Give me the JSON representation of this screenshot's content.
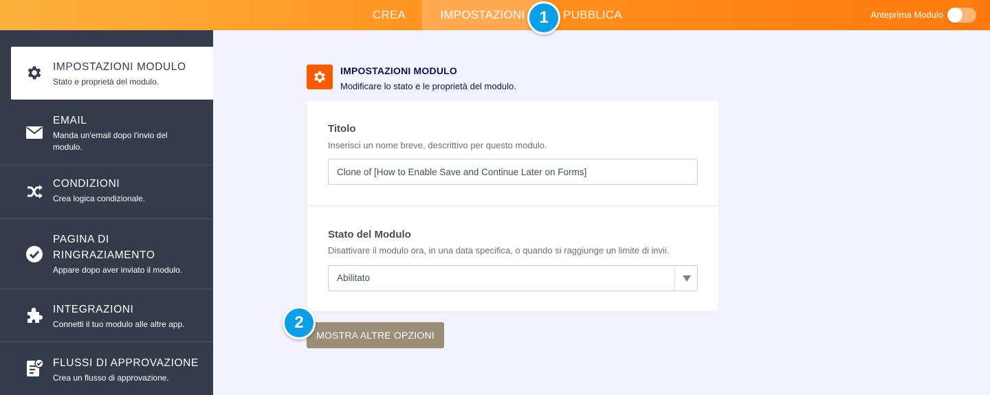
{
  "topbar": {
    "tabs": [
      {
        "label": "CREA"
      },
      {
        "label": "IMPOSTAZIONI"
      },
      {
        "label": "PUBBLICA"
      }
    ],
    "preview_label": "Anteprima Modulo",
    "preview_enabled": false
  },
  "badges": {
    "one": "1",
    "two": "2"
  },
  "sidebar": {
    "items": [
      {
        "title": "IMPOSTAZIONI MODULO",
        "desc": "Stato e proprietà del modulo.",
        "icon": "gear-icon"
      },
      {
        "title": "EMAIL",
        "desc": "Manda un'email dopo l'invio del modulo.",
        "icon": "envelope-icon"
      },
      {
        "title": "CONDIZIONI",
        "desc": "Crea logica condizionale.",
        "icon": "shuffle-icon"
      },
      {
        "title": "PAGINA DI RINGRAZIAMENTO",
        "desc": "Appare dopo aver inviato il modulo.",
        "icon": "check-circle-icon"
      },
      {
        "title": "INTEGRAZIONI",
        "desc": "Connetti il tuo modulo alle altre app.",
        "icon": "puzzle-icon"
      },
      {
        "title": "FLUSSI DI APPROVAZIONE",
        "desc": "Crea un flusso di approvazione.",
        "icon": "approval-icon"
      }
    ]
  },
  "main": {
    "title": "IMPOSTAZIONI MODULO",
    "desc": "Modificare lo stato e le proprietà del modulo.",
    "title_field": {
      "label": "Titolo",
      "desc": "Inserisci un nome breve, descrittivo per questo modulo.",
      "value": "Clone of [How to Enable Save and Continue Later on Forms]"
    },
    "status_field": {
      "label": "Stato del Modulo",
      "desc": "Disattivare il modulo ora, in una data specifica, o quando si raggiunge un limite di invii.",
      "value": "Abilitato"
    },
    "more_button": "MOSTRA ALTRE OPZIONI"
  },
  "colors": {
    "accent": "#fb5b00",
    "sidebar_bg": "#343c4c",
    "badge": "#0a9fe6",
    "button": "#9b8d78"
  }
}
